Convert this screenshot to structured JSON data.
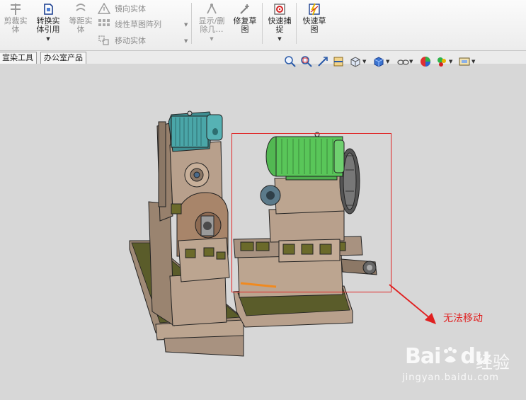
{
  "ribbon": {
    "trim_label": "剪裁实\n体",
    "convert_label": "转换实\n体引用",
    "offset_label": "等距实\n体",
    "mirror_label": "镜向实体",
    "linear_pattern_label": "线性草图阵列",
    "move_label": "移动实体",
    "display_delete_label": "显示/删\n除几…",
    "repair_label": "修复草\n图",
    "quick_snap_label": "快速捕\n捉",
    "rapid_sketch_label": "快速草\n图"
  },
  "tabs": [
    {
      "label": "宣染工具"
    },
    {
      "label": "办公室产品"
    }
  ],
  "annotation": {
    "text": "无法移动",
    "color": "#e02020"
  },
  "watermark": {
    "brand": "Bai",
    "brand2": "du",
    "chinese": "经验",
    "url": "jingyan.baidu.com"
  },
  "colors": {
    "viewport_bg": "#d7d7d7",
    "selection_box": "#e02424",
    "motor_teal": "#4aa6a8",
    "motor_green": "#59c659",
    "machine_body": "#b39a86",
    "base_olive": "#5a5c2a"
  },
  "hud_icons": [
    "zoom-to-fit-icon",
    "zoom-to-area-icon",
    "previous-view-icon",
    "section-view-icon",
    "view-orientation-icon",
    "display-style-icon",
    "hide-show-items-icon",
    "edit-appearance-icon",
    "apply-scene-icon",
    "view-settings-icon"
  ]
}
